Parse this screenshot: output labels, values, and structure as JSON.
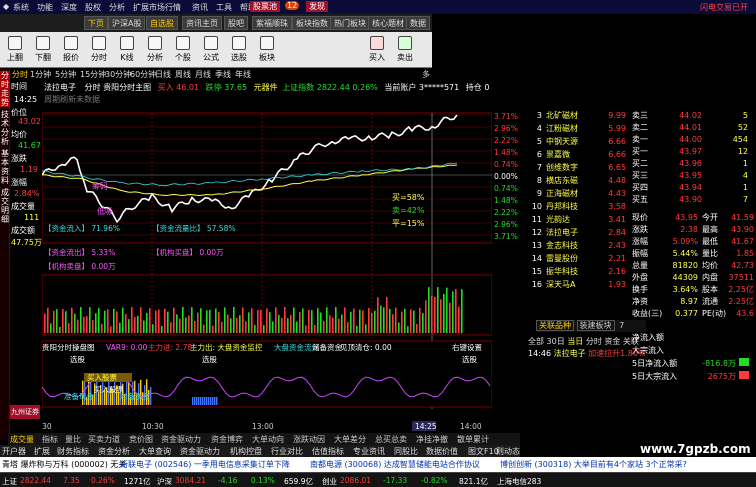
{
  "menubar": {
    "items": [
      "系统",
      "功能",
      "深度",
      "股权",
      "分析",
      "扩展市场行情",
      "资讯",
      "工具",
      "帮助"
    ],
    "center": "股票池",
    "badge": "12",
    "flag": "发现",
    "right_label": "闪电交易已开"
  },
  "tabs": [
    "下页",
    "沪深A股",
    "自选股",
    "资讯主页",
    "股吧",
    "紫福顺珠",
    "板块指数",
    "热门板块",
    "核心题材",
    "数据"
  ],
  "toolbar": [
    "上翻",
    "下翻",
    "报价",
    "分时",
    "K线",
    "分析",
    "个股",
    "公式",
    "选股",
    "板块",
    "买入",
    "卖出"
  ],
  "periods": [
    "分时",
    "1分钟",
    "5分钟",
    "15分钟",
    "30分钟",
    "60分钟",
    "日线",
    "周线",
    "月线",
    "季线",
    "年线",
    "多"
  ],
  "left_strip": [
    "分时走势",
    "技术分析",
    "基本资料",
    "成交明细"
  ],
  "info_panel": {
    "time_label": "时间",
    "time": "14:25",
    "price_label": "价位",
    "price": "43.02",
    "avg_label": "均价",
    "avg": "41.67",
    "chg_label": "涨跌",
    "chg": "1.19",
    "pct_label": "涨幅",
    "pct": "2.84%",
    "vol_label": "成交量",
    "vol": "111",
    "amt_label": "成交额",
    "amt": "47.75万"
  },
  "title_line": {
    "stock": "法拉电子",
    "mode": "分时",
    "main": "贵阳分时主图",
    "buy": "买入 46.01",
    "sell": "跌停 37.65",
    "idx_label": "元器件",
    "index": "上证指数 2822.44 0.26%",
    "account_label": "当前账户",
    "account": "3*****571",
    "hold": "持仓 0"
  },
  "subtitle": "周期刷新未数据",
  "y_labels_right": [
    "3.71%",
    "2.96%",
    "2.22%",
    "1.48%",
    "0.74%",
    "0.00%",
    "0.74%",
    "1.48%",
    "2.22%",
    "2.96%",
    "3.71%"
  ],
  "chart_labels": {
    "zc": "筹码",
    "low": "低吸",
    "fund_in": "【资金流入】 71.96%",
    "fund_out": "【资金流出】 5.33%",
    "fund_flow": "【资金流量比】 57.58%",
    "mid_buy": "买=58%",
    "mid_sell": "卖=42%",
    "mid_sell2": "平=15%",
    "inst_buy": "【机构买盘】 0.00万",
    "inst_sell": "【机构卖盘】 0.00万",
    "vol_right": "542",
    "vol_right2": "344"
  },
  "lower_title": {
    "name": "贵阳分时操盘图",
    "var": "VAR9: 0.00",
    "main_flow": "主力进: 2.78",
    "main_out": "主力出: 大盘资金监控",
    "big_ratio": "大盘资金流入",
    "reserve": "储备资金",
    "funds": "见顶清仓: 0.00",
    "right": "右键设置"
  },
  "lower_labels": {
    "select1": "选股",
    "select2": "选股",
    "select3": "选股",
    "buy_in": "买入股票",
    "buy_in2": "买入股票",
    "ready": "准备现金",
    "ready2": "准备现金",
    "broker": "九州证券"
  },
  "time_axis": [
    "09:30",
    "10:30",
    "13:00",
    "14:25",
    "14:00"
  ],
  "bottom_tabs": [
    "成交量",
    "指标",
    "量比",
    "买卖力道",
    "竞价图",
    "资金驱动力",
    "资金博弈",
    "大单动向",
    "涨跌动因",
    "大单差分",
    "总买总卖",
    "净挂净撤",
    "散单累计"
  ],
  "page_bar": [
    "开户器",
    "扩展",
    "财务指标",
    "资金分析",
    "大单查询",
    "资金驱动力",
    "机构控盘",
    "行业对比",
    "估值指标",
    "专业资讯",
    "同股比",
    "数据价值"
  ],
  "page_bar_right": [
    "图文F10",
    "则动态"
  ],
  "sectors": [
    {
      "rank": "3",
      "name": "北矿磁材",
      "price": "9.99",
      "pct": ""
    },
    {
      "rank": "4",
      "name": "江粉磁材",
      "price": "5.99",
      "pct": ""
    },
    {
      "rank": "5",
      "name": "中钢天源",
      "price": "6.66",
      "pct": ""
    },
    {
      "rank": "6",
      "name": "景嘉微",
      "price": "6.66",
      "pct": ""
    },
    {
      "rank": "7",
      "name": "创维数字",
      "price": "6.65",
      "pct": ""
    },
    {
      "rank": "8",
      "name": "横店东磁",
      "price": "4.48",
      "pct": ""
    },
    {
      "rank": "9",
      "name": "正海磁材",
      "price": "4.43",
      "pct": ""
    },
    {
      "rank": "10",
      "name": "丹邦科技",
      "price": "3.58",
      "pct": ""
    },
    {
      "rank": "11",
      "name": "光韵达",
      "price": "3.41",
      "pct": ""
    },
    {
      "rank": "12",
      "name": "法拉电子",
      "price": "2.84",
      "pct": ""
    },
    {
      "rank": "13",
      "name": "金志科技",
      "price": "2.43",
      "pct": ""
    },
    {
      "rank": "14",
      "name": "雷曼股份",
      "price": "2.21",
      "pct": ""
    },
    {
      "rank": "15",
      "name": "振华科技",
      "price": "2.16",
      "pct": ""
    },
    {
      "rank": "16",
      "name": "深天马A",
      "price": "1.93",
      "pct": ""
    }
  ],
  "order_book": [
    {
      "label": "卖三",
      "price": "44.02",
      "vol": "5"
    },
    {
      "label": "卖二",
      "price": "44.01",
      "vol": "52"
    },
    {
      "label": "卖一",
      "price": "44.00",
      "vol": "454"
    },
    {
      "label": "买一",
      "price": "43.97",
      "vol": "12"
    },
    {
      "label": "买二",
      "price": "43.96",
      "vol": "1"
    },
    {
      "label": "买三",
      "price": "43.95",
      "vol": "4"
    },
    {
      "label": "买四",
      "price": "43.94",
      "vol": "1"
    },
    {
      "label": "买五",
      "price": "43.90",
      "vol": "7"
    }
  ],
  "stats": [
    {
      "k": "现价",
      "v": "43.95",
      "k2": "今开",
      "v2": "41.59"
    },
    {
      "k": "涨跌",
      "v": "2.38",
      "k2": "最高",
      "v2": "43.90"
    },
    {
      "k": "涨幅",
      "v": "5.09%",
      "k2": "最低",
      "v2": "41.67"
    },
    {
      "k": "振幅",
      "v": "5.44%",
      "k2": "量比",
      "v2": "1.85"
    },
    {
      "k": "总量",
      "v": "81820",
      "k2": "均价",
      "v2": "42.73"
    },
    {
      "k": "外盘",
      "v": "44309",
      "k2": "内盘",
      "v2": "37511"
    },
    {
      "k": "换手",
      "v": "3.64%",
      "k2": "股本",
      "v2": "2.25亿"
    },
    {
      "k": "净资",
      "v": "8.97",
      "k2": "流通",
      "v2": "2.25亿"
    },
    {
      "k": "收益(三)",
      "v": "0.377",
      "k2": "PE(动)",
      "v2": "43.6"
    }
  ],
  "right_tabs": [
    "关联品种",
    "装建板块",
    "7"
  ],
  "quick_row": [
    "全部",
    "30日",
    "当日",
    "分时",
    "资金",
    "关联"
  ],
  "alert": {
    "time": "14:46",
    "name": "法拉电子",
    "msg": "加速拉升1.80%"
  },
  "flows": [
    {
      "k": "净流入额",
      "v": ""
    },
    {
      "k": "大宗流入",
      "v": ""
    },
    {
      "k": "5日净流入额",
      "v": "-816.8万"
    },
    {
      "k": "5日大宗流入",
      "v": "2675万"
    }
  ],
  "news": [
    {
      "text": "青塔 爆炸称与万科 (000002) 无关",
      "color": "#000"
    },
    {
      "text": "新联电子 (002546) 一季用电信息采集订单下降",
      "color": "#0033aa"
    },
    {
      "text": "南都电源 (300068) 达成智慧储能电站合作协议",
      "color": "#0033aa"
    },
    {
      "text": "博创创新 (300318) 大举目前有4个家站 3个正常采?",
      "color": "#0033aa"
    }
  ],
  "status": [
    {
      "text": "上证",
      "c": "#fff"
    },
    {
      "text": "2822.44",
      "c": "#ff3b3b"
    },
    {
      "text": "7.35",
      "c": "#ff3b3b"
    },
    {
      "text": "0.26%",
      "c": "#ff3b3b"
    },
    {
      "text": "1271亿",
      "c": "#fff"
    },
    {
      "text": "沪深",
      "c": "#fff"
    },
    {
      "text": "3084.21",
      "c": "#ff3b3b"
    },
    {
      "text": "-4.16",
      "c": "#22dd22"
    },
    {
      "text": "0.13%",
      "c": "#22dd22"
    },
    {
      "text": "659.9亿",
      "c": "#fff"
    },
    {
      "text": "创业",
      "c": "#fff"
    },
    {
      "text": "2086.01",
      "c": "#ff3b3b"
    },
    {
      "text": "-17.33",
      "c": "#22dd22"
    },
    {
      "text": "-0.82%",
      "c": "#22dd22"
    },
    {
      "text": "821.1亿",
      "c": "#fff"
    },
    {
      "text": "上海电信283",
      "c": "#fff"
    }
  ],
  "watermark": "www.7gpzb.com",
  "colors": {
    "up": "#ff3b3b",
    "down": "#22dd22",
    "grid": "#7a0000",
    "bg": "#000000"
  }
}
